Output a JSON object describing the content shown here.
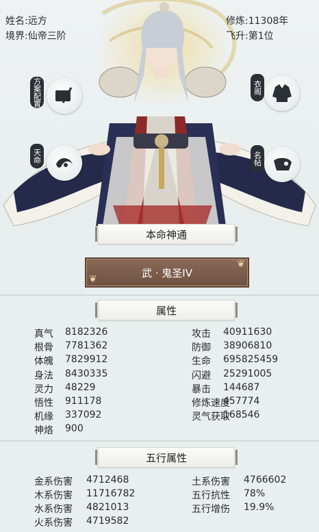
{
  "top": {
    "name_label": "姓名:",
    "name_value": "远方",
    "realm_label": "境界:",
    "realm_value": "仙帝三阶",
    "cultivate_label": "修炼:",
    "cultivate_value": "11308年",
    "ascend_label": "飞升:",
    "ascend_value": "第1位"
  },
  "side_buttons": {
    "left_top": "方案配置",
    "left_bottom": "天命",
    "right_top": "衣阁",
    "right_bottom": "名帖"
  },
  "sections": {
    "natal_title": "本命神通",
    "skill_name": "武 · 鬼圣IV",
    "attr_title": "属性",
    "wuxing_title": "五行属性"
  },
  "attributes": {
    "left": [
      {
        "label": "真气",
        "value": "8182326"
      },
      {
        "label": "根骨",
        "value": "7781362"
      },
      {
        "label": "体魄",
        "value": "7829912"
      },
      {
        "label": "身法",
        "value": "8430335"
      },
      {
        "label": "灵力",
        "value": "48229"
      },
      {
        "label": "悟性",
        "value": "911178"
      },
      {
        "label": "机缘",
        "value": "337092"
      },
      {
        "label": "神烙",
        "value": "900"
      }
    ],
    "right": [
      {
        "label": "攻击",
        "value": "40911630"
      },
      {
        "label": "防御",
        "value": "38906810"
      },
      {
        "label": "生命",
        "value": "695825459"
      },
      {
        "label": "闪避",
        "value": "25291005"
      },
      {
        "label": "暴击",
        "value": "144687"
      },
      {
        "label": "修炼速度",
        "value": "457774"
      },
      {
        "label": "灵气获取",
        "value": "168546"
      }
    ]
  },
  "wuxing": {
    "left": [
      {
        "label": "金系伤害",
        "value": "4712468"
      },
      {
        "label": "木系伤害",
        "value": "11716782"
      },
      {
        "label": "水系伤害",
        "value": "4821013"
      },
      {
        "label": "火系伤害",
        "value": "4719582"
      }
    ],
    "right": [
      {
        "label": "土系伤害",
        "value": "4766602"
      },
      {
        "label": "五行抗性",
        "value": "78%"
      },
      {
        "label": "五行增伤",
        "value": "19.9%"
      }
    ]
  },
  "colors": {
    "background": "#e9eeee",
    "skill_button": "#7a5c4a",
    "tag_dark": "#2b2f36"
  }
}
